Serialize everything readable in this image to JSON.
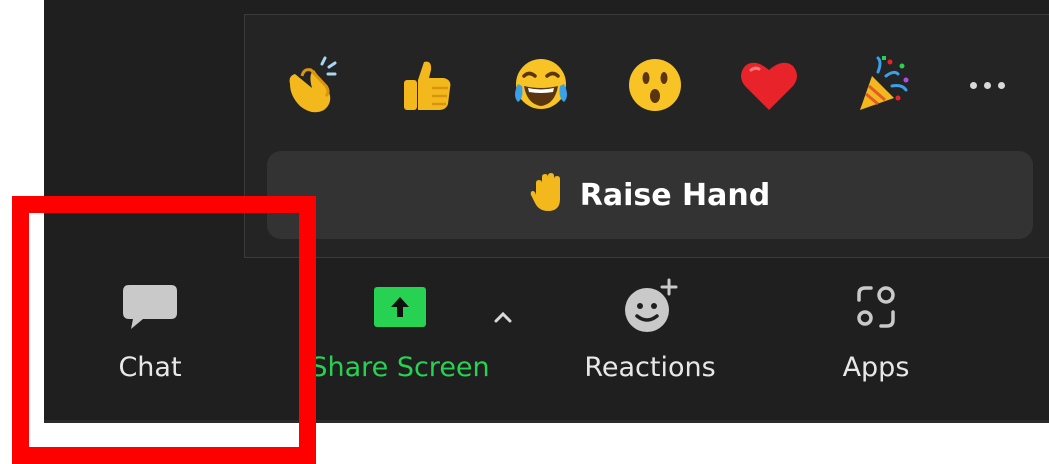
{
  "reactions_popup": {
    "emojis": [
      {
        "name": "clapping-hands"
      },
      {
        "name": "thumbs-up"
      },
      {
        "name": "tears-of-joy"
      },
      {
        "name": "surprised-face"
      },
      {
        "name": "red-heart"
      },
      {
        "name": "party-popper"
      }
    ],
    "more_icon": "ellipsis-icon",
    "raise_hand": {
      "icon": "raised-hand-icon",
      "label": "Raise Hand"
    }
  },
  "toolbar": {
    "chat": {
      "label": "Chat",
      "icon": "chat-bubble-icon"
    },
    "share_screen": {
      "label": "Share Screen",
      "icon": "share-screen-icon",
      "options_icon": "caret-up-icon"
    },
    "reactions": {
      "label": "Reactions",
      "icon": "smiley-plus-icon"
    },
    "apps": {
      "label": "Apps",
      "icon": "apps-icon"
    }
  },
  "colors": {
    "background": "#1f1f1f",
    "popup_background": "#242424",
    "raise_hand_button": "#333333",
    "share_screen_green": "#27d152",
    "highlight_box": "#ff0000"
  }
}
